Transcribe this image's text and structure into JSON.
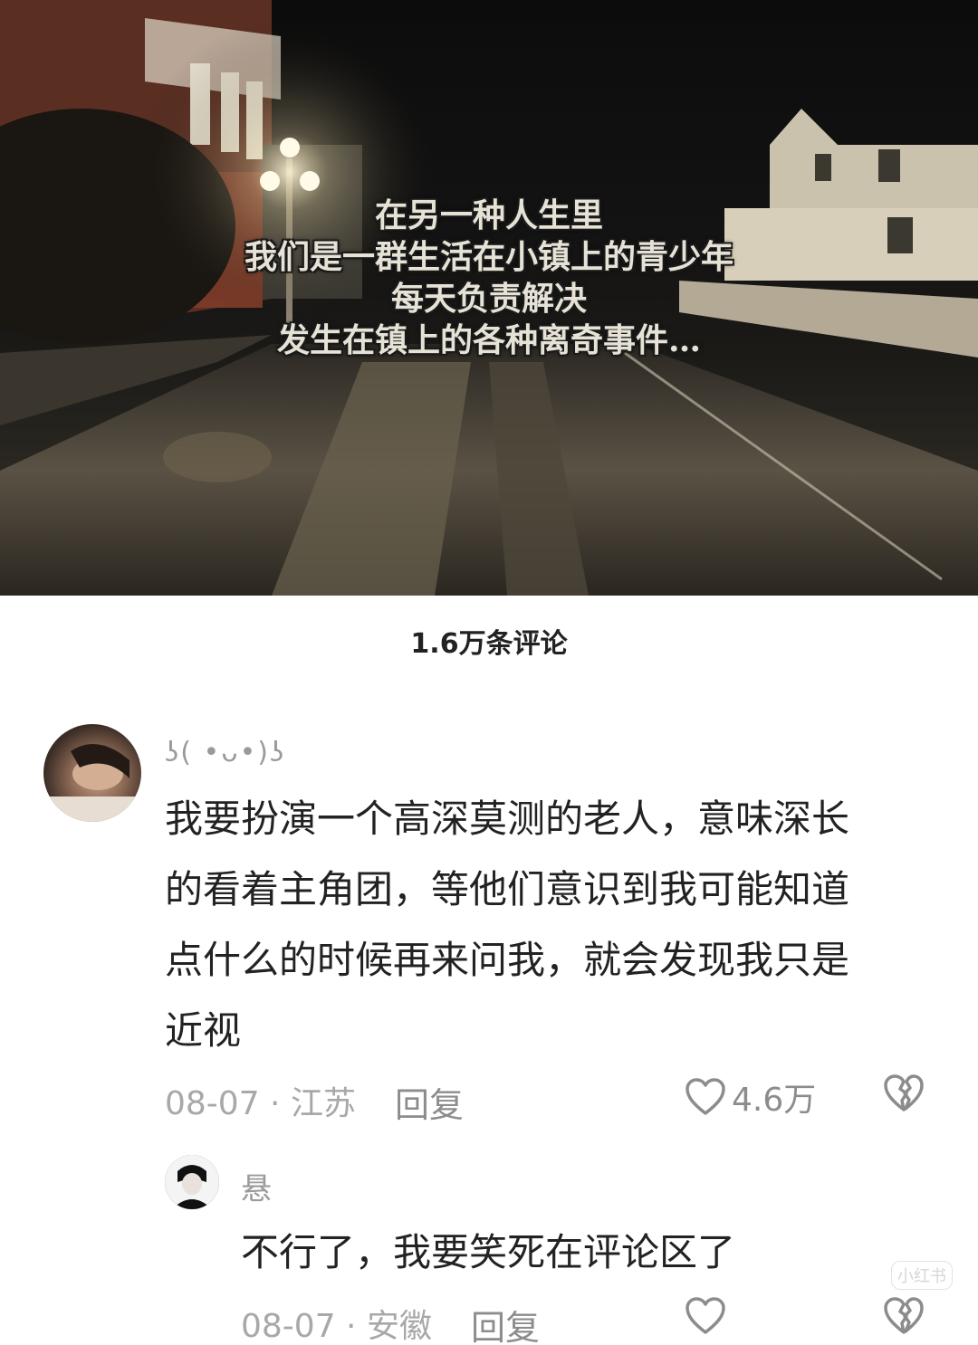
{
  "video": {
    "caption_lines": [
      "在另一种人生里",
      "我们是一群生活在小镇上的青少年",
      "每天负责解决",
      "发生在镇上的各种离奇事件…"
    ]
  },
  "comments_header": {
    "count_label": "1.6万条评论"
  },
  "comments": [
    {
      "username": "ʖ(  •ᴗ•)ʖ",
      "text_lines": [
        "我要扮演一个高深莫测的老人，意味深长",
        "的看着主角团，等他们意识到我可能知道",
        "点什么的时候再来问我，就会发现我只是",
        "近视"
      ],
      "meta": "08-07 · 江苏",
      "reply_label": "回复",
      "like_count": "4.6万",
      "avatar_icon": "avatar-photo"
    },
    {
      "username": "悬",
      "text_lines": [
        "不行了，我要笑死在评论区了"
      ],
      "meta": "08-07 · 安徽",
      "reply_label": "回复",
      "like_count": "",
      "avatar_icon": "avatar-photo"
    }
  ],
  "watermark": "小红书",
  "colors": {
    "muted": "#9a9a9a",
    "text": "#222222",
    "icon": "#8c8c8c"
  }
}
